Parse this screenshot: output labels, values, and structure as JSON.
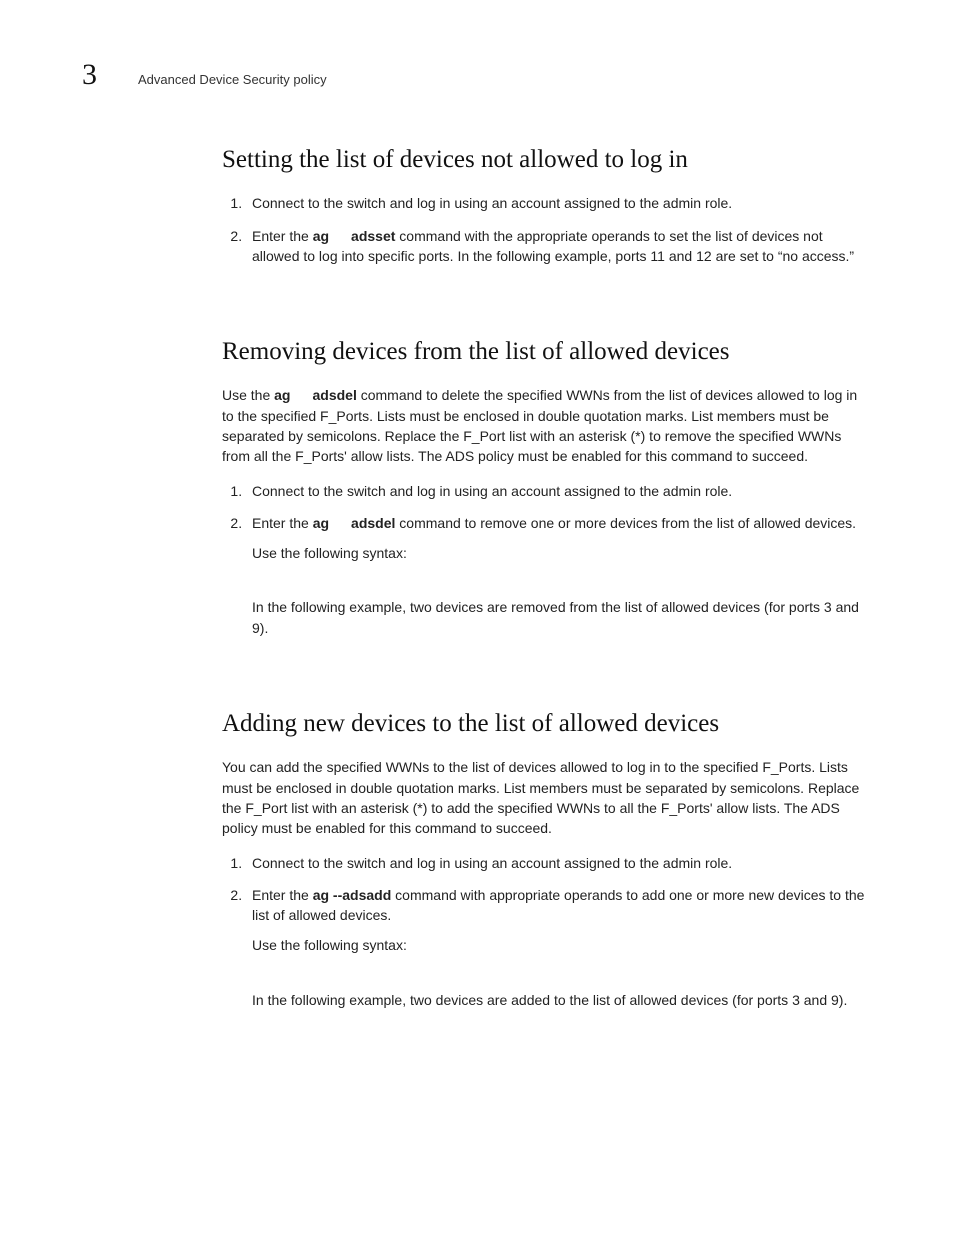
{
  "header": {
    "chapter_number": "3",
    "running_title": "Advanced Device Security policy"
  },
  "sections": {
    "s1": {
      "heading": "Setting the list of devices not allowed to log in",
      "step1": "Connect to the switch and log in using an account assigned to the admin role.",
      "step2_pre": "Enter the ",
      "step2_cmd_a": "ag",
      "step2_cmd_b": "adsset",
      "step2_post": " command with the appropriate operands to set the list of devices not allowed to log into specific ports. In the following example, ports 11 and 12 are set to “no access.”"
    },
    "s2": {
      "heading": "Removing devices from the list of allowed devices",
      "intro_pre": "Use the ",
      "intro_cmd_a": "ag",
      "intro_cmd_b": "adsdel",
      "intro_post": " command to delete the specified WWNs from the list of devices allowed to log in to the specified F_Ports. Lists must be enclosed in double quotation marks. List members must be separated by semicolons. Replace the F_Port list with an asterisk (*) to remove the specified WWNs from all the F_Ports' allow lists. The ADS policy must be enabled for this command to succeed.",
      "step1": "Connect to the switch and log in using an account assigned to the admin role.",
      "step2_pre": "Enter the ",
      "step2_cmd_a": "ag",
      "step2_cmd_b": "adsdel",
      "step2_post": " command to remove one or more devices from the list of allowed devices.",
      "step2_syntax_label": "Use the following syntax:",
      "step2_example": "In the following example, two devices are removed from the list of allowed devices (for ports 3 and 9)."
    },
    "s3": {
      "heading": "Adding new devices to the list of allowed devices",
      "intro": "You can add the specified WWNs to the list of devices allowed to log in to the specified F_Ports. Lists must be enclosed in double quotation marks. List members must be separated by semicolons. Replace the F_Port list with an asterisk (*) to add the specified WWNs to all the F_Ports' allow lists. The ADS policy must be enabled for this command to succeed.",
      "step1": "Connect to the switch and log in using an account assigned to the admin role.",
      "step2_pre": "Enter the ",
      "step2_cmd": "ag --adsadd",
      "step2_post": " command with appropriate operands to add one or more new devices to the list of allowed devices.",
      "step2_syntax_label": "Use the following syntax:",
      "step2_example": "In the following example, two devices are added to the list of allowed devices (for ports 3 and 9)."
    }
  }
}
